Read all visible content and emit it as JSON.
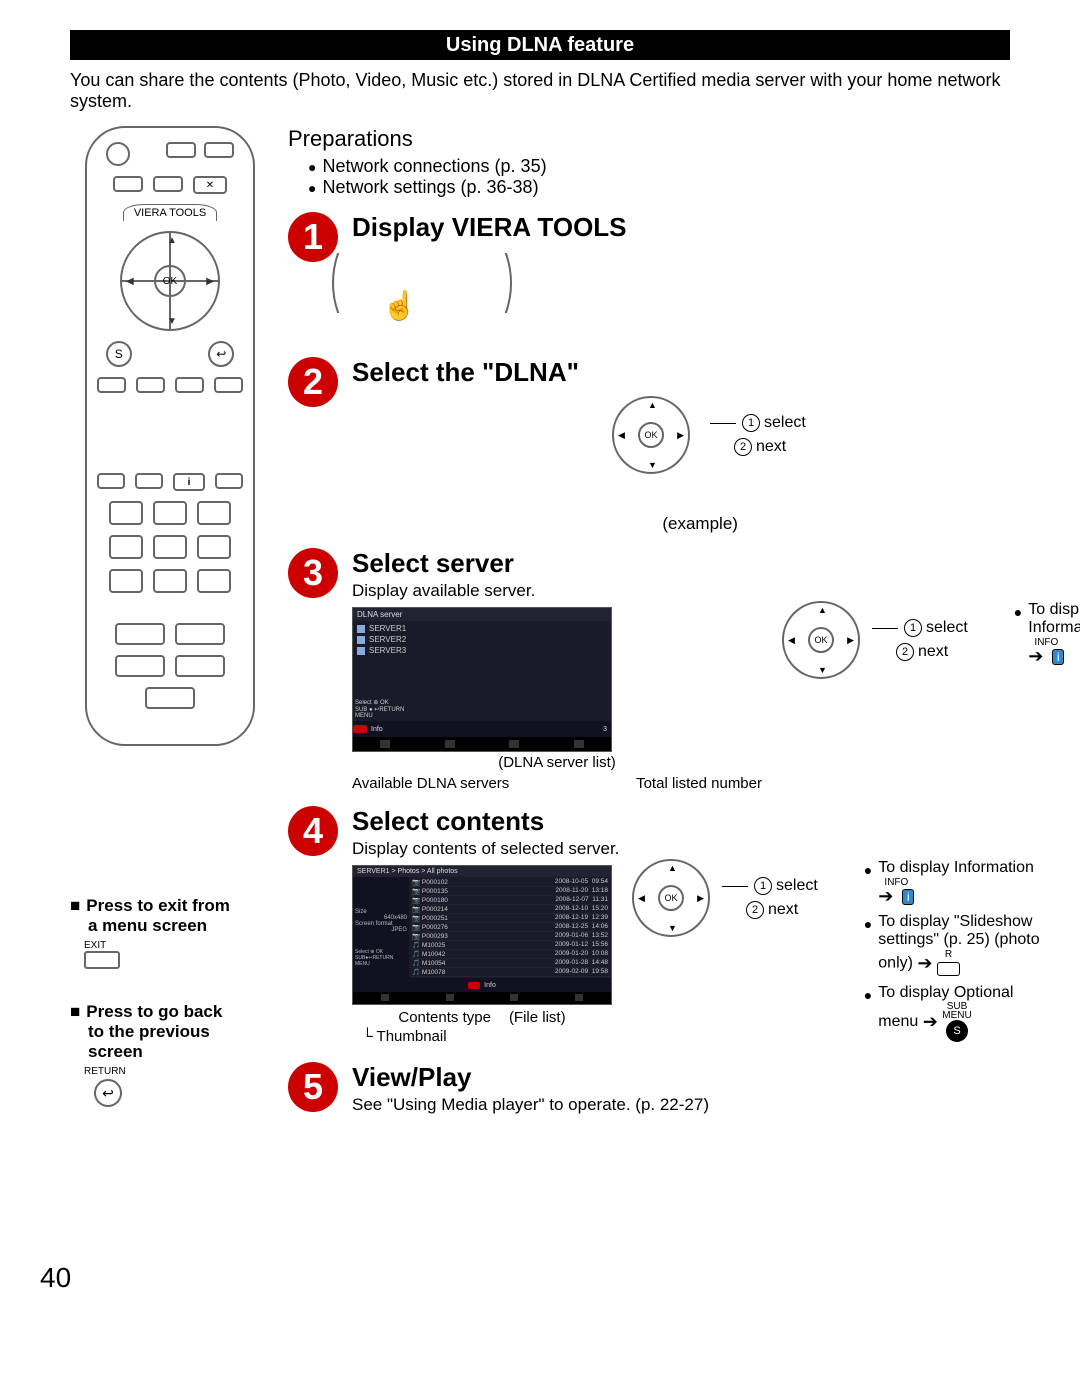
{
  "section_title": "Using DLNA feature",
  "intro": "You can share the contents (Photo, Video, Music etc.) stored in DLNA Certified media server with your home network system.",
  "page_number": "40",
  "remote": {
    "viera_tools_label": "VIERA TOOLS",
    "ok_label": "OK",
    "s_label": "S",
    "return_glyph": "↩"
  },
  "preparations": {
    "title": "Preparations",
    "items": [
      "Network connections (p. 35)",
      "Network settings (p. 36-38)"
    ]
  },
  "steps": {
    "s1": {
      "num": "1",
      "title": "Display VIERA TOOLS"
    },
    "s2": {
      "num": "2",
      "title": "Select the \"DLNA\"",
      "pad": {
        "ok": "OK",
        "l1_num": "1",
        "l1": "select",
        "l2_num": "2",
        "l2": "next"
      }
    },
    "example_label": "(example)",
    "s3": {
      "num": "3",
      "title": "Select server",
      "sub": "Display available server.",
      "screen_header": "DLNA server",
      "servers": [
        "SERVER1",
        "SERVER2",
        "SERVER3"
      ],
      "screen_footer_info": "Info",
      "caption_center": "(DLNA server list)",
      "under_left": "Available DLNA servers",
      "under_right": "Total listed number",
      "pad": {
        "ok": "OK",
        "l1_num": "1",
        "l1": "select",
        "l2_num": "2",
        "l2": "next"
      },
      "info_line": "To display Information",
      "info_over": "INFO",
      "info_icon": "i"
    },
    "s4": {
      "num": "4",
      "title": "Select contents",
      "sub": "Display contents of selected server.",
      "breadcrumb": "SERVER1 > Photos > All photos",
      "side_size_lbl": "Size",
      "side_size_val": "640x480",
      "side_fmt_lbl": "Screen format",
      "side_fmt_val": "JPEG",
      "files": [
        {
          "ico": "📷",
          "name": "P000102",
          "date": "2008-10-05",
          "time": "09:54"
        },
        {
          "ico": "📷",
          "name": "P000135",
          "date": "2008-11-20",
          "time": "13:18"
        },
        {
          "ico": "📷",
          "name": "P000180",
          "date": "2008-12-07",
          "time": "11:31"
        },
        {
          "ico": "📷",
          "name": "P000214",
          "date": "2008-12-10",
          "time": "15:20"
        },
        {
          "ico": "📷",
          "name": "P000251",
          "date": "2008-12-19",
          "time": "12:39"
        },
        {
          "ico": "📷",
          "name": "P000276",
          "date": "2008-12-25",
          "time": "14:06"
        },
        {
          "ico": "📷",
          "name": "P000293",
          "date": "2009-01-06",
          "time": "13:52"
        },
        {
          "ico": "🎵",
          "name": "M10025",
          "date": "2009-01-12",
          "time": "15:56"
        },
        {
          "ico": "🎵",
          "name": "M10042",
          "date": "2009-01-20",
          "time": "10:08"
        },
        {
          "ico": "🎵",
          "name": "M10054",
          "date": "2009-01-28",
          "time": "14:48"
        },
        {
          "ico": "🎵",
          "name": "M10078",
          "date": "2009-02-09",
          "time": "19:58"
        }
      ],
      "footer_info": "Info",
      "cap_contents_type": "Contents type",
      "cap_file_list": "(File list)",
      "thumb_label": "Thumbnail",
      "pad": {
        "ok": "OK",
        "l1_num": "1",
        "l1": "select",
        "l2_num": "2",
        "l2": "next"
      },
      "info": {
        "line1": "To display Information",
        "info_over": "INFO",
        "info_icon": "i",
        "line2a": "To display \"Slideshow",
        "line2b": "settings\" (p. 25) (photo",
        "line2c": "only)",
        "r_over": "R",
        "line3a": "To display Optional",
        "line3b": "menu",
        "sub_over1": "SUB",
        "sub_over2": "MENU",
        "s_label": "S"
      }
    },
    "s5": {
      "num": "5",
      "title": "View/Play",
      "sub": "See \"Using Media player\" to operate. (p. 22-27)"
    }
  },
  "left_instructions": {
    "exit_title1": "Press to exit from",
    "exit_title2": "a menu screen",
    "exit_over": "EXIT",
    "back_title1": "Press to go back",
    "back_title2": "to the previous",
    "back_title3": "screen",
    "return_over": "RETURN",
    "return_glyph": "↩"
  }
}
